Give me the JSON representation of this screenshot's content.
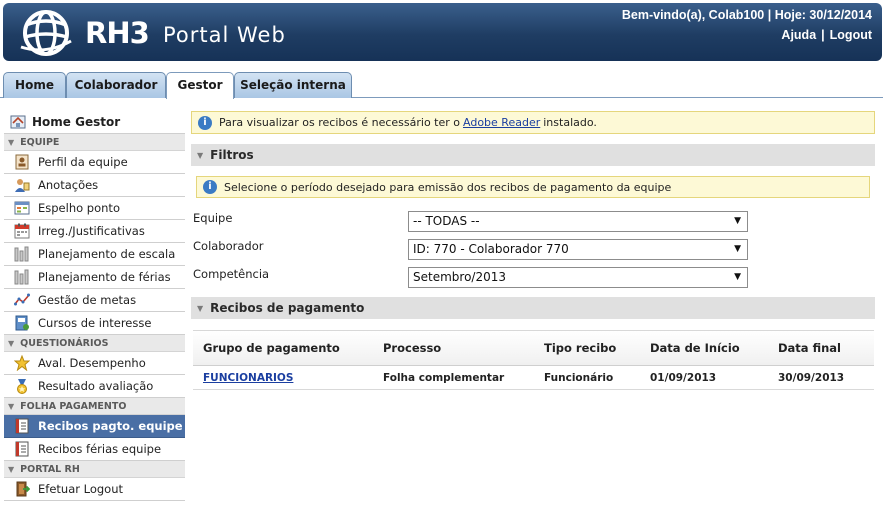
{
  "header": {
    "logo_mark": "RH3",
    "logo_text": "Portal Web",
    "welcome": "Bem-vindo(a), Colab100 | Hoje: 30/12/2014",
    "help_link": "Ajuda",
    "logout_link": "Logout",
    "separator": "|"
  },
  "tabs": [
    {
      "label": "Home"
    },
    {
      "label": "Colaborador"
    },
    {
      "label": "Gestor",
      "active": true
    },
    {
      "label": "Seleção interna"
    }
  ],
  "sidebar": {
    "home_label": "Home Gestor",
    "sections": [
      {
        "title": "EQUIPE",
        "items": [
          "Perfil da equipe",
          "Anotações",
          "Espelho ponto",
          "Irreg./Justificativas",
          "Planejamento de escala",
          "Planejamento de férias",
          "Gestão de metas",
          "Cursos de interesse"
        ]
      },
      {
        "title": "QUESTIONÁRIOS",
        "items": [
          "Aval. Desempenho",
          "Resultado avaliação"
        ]
      },
      {
        "title": "FOLHA PAGAMENTO",
        "items": [
          "Recibos pagto. equipe",
          "Recibos férias equipe"
        ]
      },
      {
        "title": "PORTAL RH",
        "items": [
          "Efetuar Logout"
        ]
      }
    ],
    "active_item": "Recibos pagto. equipe"
  },
  "notice": {
    "before": "Para visualizar os recibos é necessário ter o",
    "link": "Adobe Reader",
    "after": "instalado."
  },
  "filters": {
    "title": "Filtros",
    "notice": "Selecione o período desejado para emissão dos recibos de pagamento da equipe",
    "equipe_label": "Equipe",
    "equipe_value": "-- TODAS --",
    "colaborador_label": "Colaborador",
    "colaborador_value": "ID: 770 - Colaborador 770",
    "competencia_label": "Competência",
    "competencia_value": "Setembro/2013"
  },
  "receipts": {
    "title": "Recibos de pagamento",
    "columns": [
      "Grupo de pagamento",
      "Processo",
      "Tipo recibo",
      "Data de Início",
      "Data final"
    ],
    "rows": [
      [
        "FUNCIONARIOS",
        "Folha complementar",
        "Funcionário",
        "01/09/2013",
        "30/09/2013"
      ]
    ]
  },
  "colors": {
    "header_blue": "#1f3d63",
    "tab_blue": "#a9c6e4",
    "active_sidebar": "#4a6fa5",
    "notice_bg": "#fdf9d6"
  }
}
